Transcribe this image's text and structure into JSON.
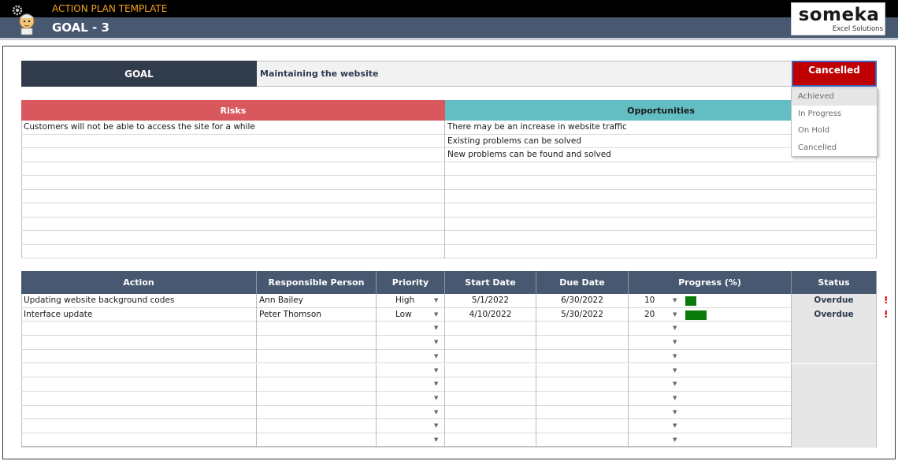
{
  "header": {
    "app_title": "ACTION PLAN TEMPLATE",
    "goal_title": "GOAL - 3",
    "logo_main": "someka",
    "logo_sub": "Excel Solutions"
  },
  "goal": {
    "label": "GOAL",
    "value": "Maintaining the website",
    "status": "Cancelled",
    "status_color": "#c00000"
  },
  "status_dropdown": {
    "options": [
      "Achieved",
      "In Progress",
      "On Hold",
      "Cancelled"
    ],
    "highlighted": "Achieved"
  },
  "risks": {
    "header": "Risks",
    "header_color": "#d9585e",
    "items": [
      "Customers will not be able to access the site for a while",
      "",
      "",
      "",
      "",
      "",
      "",
      "",
      "",
      ""
    ]
  },
  "opportunities": {
    "header": "Opportunities",
    "header_color": "#63bec4",
    "items": [
      "There may be an increase in website traffic",
      "Existing problems can be solved",
      "New problems can be found and solved",
      "",
      "",
      "",
      "",
      "",
      "",
      ""
    ]
  },
  "actions": {
    "columns": [
      "Action",
      "Responsible Person",
      "Priority",
      "Start Date",
      "Due Date",
      "Progress (%)",
      "Status"
    ],
    "rows": [
      {
        "action": "Updating website background codes",
        "person": "Ann Bailey",
        "priority": "High",
        "start": "5/1/2022",
        "due": "6/30/2022",
        "progress": "10",
        "status": "Overdue",
        "alert": "!"
      },
      {
        "action": "Interface update",
        "person": "Peter Thomson",
        "priority": "Low",
        "start": "4/10/2022",
        "due": "5/30/2022",
        "progress": "20",
        "status": "Overdue",
        "alert": "!"
      },
      {
        "action": "",
        "person": "",
        "priority": "",
        "start": "",
        "due": "",
        "progress": "",
        "status": "",
        "alert": ""
      },
      {
        "action": "",
        "person": "",
        "priority": "",
        "start": "",
        "due": "",
        "progress": "",
        "status": "",
        "alert": ""
      },
      {
        "action": "",
        "person": "",
        "priority": "",
        "start": "",
        "due": "",
        "progress": "",
        "status": "",
        "alert": ""
      },
      {
        "action": "",
        "person": "",
        "priority": "",
        "start": "",
        "due": "",
        "progress": "",
        "status": "",
        "alert": ""
      },
      {
        "action": "",
        "person": "",
        "priority": "",
        "start": "",
        "due": "",
        "progress": "",
        "status": "",
        "alert": ""
      },
      {
        "action": "",
        "person": "",
        "priority": "",
        "start": "",
        "due": "",
        "progress": "",
        "status": "",
        "alert": ""
      },
      {
        "action": "",
        "person": "",
        "priority": "",
        "start": "",
        "due": "",
        "progress": "",
        "status": "",
        "alert": ""
      },
      {
        "action": "",
        "person": "",
        "priority": "",
        "start": "",
        "due": "",
        "progress": "",
        "status": "",
        "alert": ""
      },
      {
        "action": "",
        "person": "",
        "priority": "",
        "start": "",
        "due": "",
        "progress": "",
        "status": "",
        "alert": ""
      }
    ],
    "progress_bar_color": "#0a7a0a"
  },
  "icons": {
    "app_icon": "scientist-gear-icon",
    "dropdown_caret": "caret-down-icon",
    "alert": "exclamation-icon"
  }
}
